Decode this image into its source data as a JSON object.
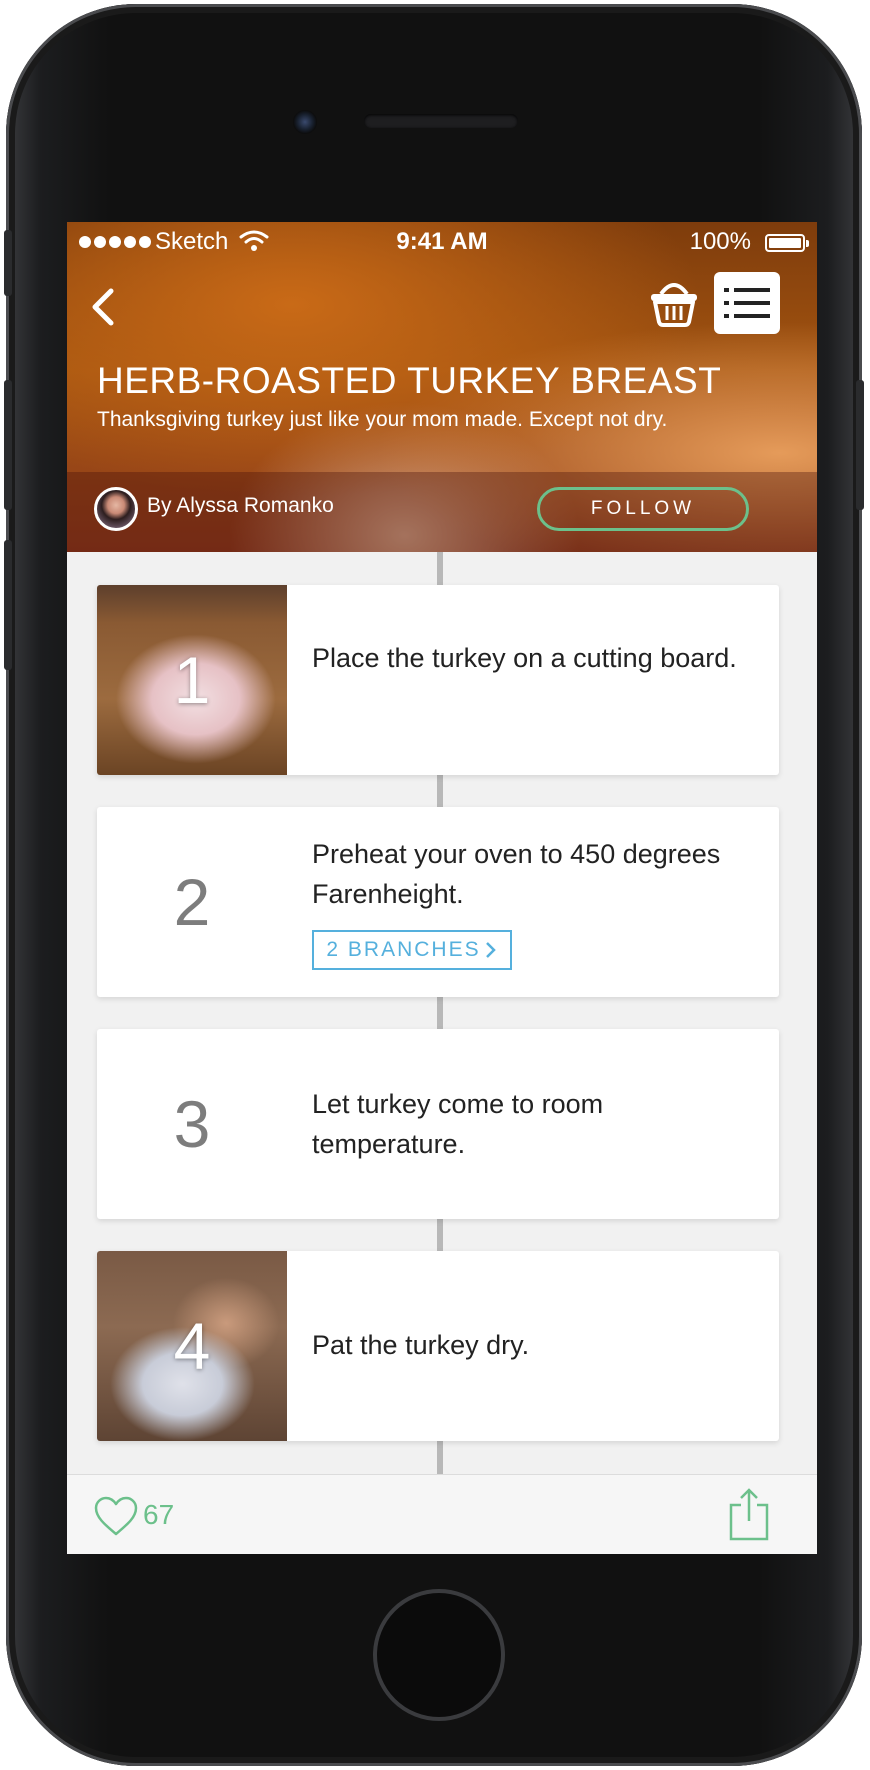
{
  "status_bar": {
    "carrier": "Sketch",
    "time": "9:41 AM",
    "battery": "100%"
  },
  "recipe": {
    "title": "HERB-ROASTED TURKEY BREAST",
    "subtitle": "Thanksgiving turkey just like your mom made. Except not dry.",
    "author": "By Alyssa Romanko",
    "follow_label": "FOLLOW"
  },
  "steps": [
    {
      "number": "1",
      "text": "Place the turkey on a cutting board.",
      "has_photo": true
    },
    {
      "number": "2",
      "text": "Preheat your oven to 450 degrees Farenheight.",
      "branches_label": "2 BRANCHES",
      "has_photo": false
    },
    {
      "number": "3",
      "text": "Let turkey come to room temperature.",
      "has_photo": false
    },
    {
      "number": "4",
      "text": "Pat the turkey dry.",
      "has_photo": true
    }
  ],
  "footer": {
    "like_count": "67"
  },
  "icons": {
    "back": "chevron-left-icon",
    "basket": "basket-icon",
    "list": "list-icon",
    "like": "heart-icon",
    "share": "share-icon"
  },
  "colors": {
    "accent_green": "#6cc08b",
    "branch_blue": "#55b0dd"
  }
}
